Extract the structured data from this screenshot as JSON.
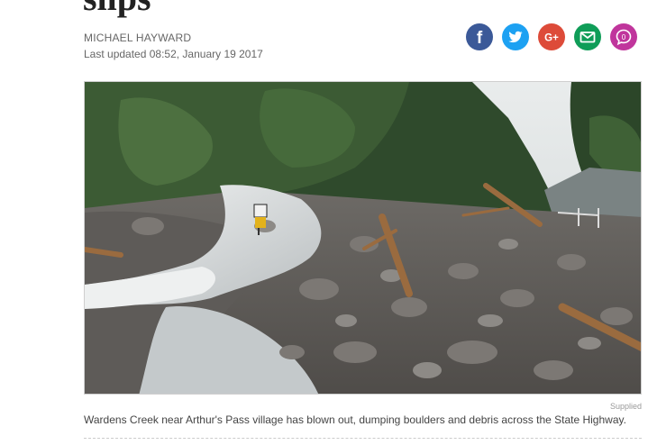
{
  "article": {
    "headline_fragment": "slips",
    "author": "MICHAEL HAYWARD",
    "updated": "Last updated 08:52, January 19 2017"
  },
  "share": [
    {
      "name": "facebook-share-button",
      "icon": "facebook-icon",
      "color": "#3b5998"
    },
    {
      "name": "twitter-share-button",
      "icon": "twitter-icon",
      "color": "#1da1f2"
    },
    {
      "name": "google-plus-share-button",
      "icon": "google-plus-icon",
      "color": "#dd4b39"
    },
    {
      "name": "email-share-button",
      "icon": "email-icon",
      "color": "#0f9d58"
    },
    {
      "name": "comments-share-button",
      "icon": "comments-icon",
      "color": "#c0359c"
    }
  ],
  "share_glyphs": {
    "facebook": "f",
    "google_plus": "G+",
    "comments": "0"
  },
  "photo": {
    "credit": "Supplied",
    "caption": "Wardens Creek near Arthur's Pass village has blown out, dumping boulders and debris across the State Highway."
  }
}
